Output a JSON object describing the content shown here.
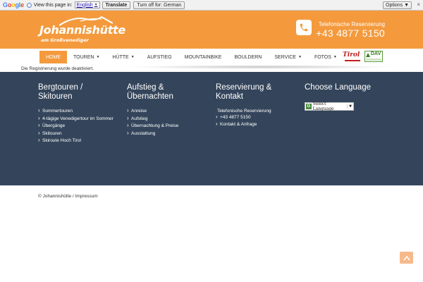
{
  "translate_bar": {
    "logo_letters": [
      "G",
      "o",
      "o",
      "g",
      "l",
      "e"
    ],
    "view_label": "View this page in:",
    "language": "English",
    "translate_button": "Translate",
    "turn_off_button": "Turn off for: German",
    "options_button": "Options ▼",
    "close": "×"
  },
  "header": {
    "logo_name": "Johannishütte",
    "logo_sub": "am Großvenediger",
    "phone_label": "Telefonische Reservierung",
    "phone_number": "+43 4877 5150",
    "accent_color": "#f49a3d"
  },
  "nav": {
    "items": [
      {
        "label": "HOME",
        "caret": ""
      },
      {
        "label": "TOUREN",
        "caret": "▼"
      },
      {
        "label": "HÜTTE",
        "caret": "▼"
      },
      {
        "label": "AUFSTIEG",
        "caret": ""
      },
      {
        "label": "MOUNTAINBIKE",
        "caret": ""
      },
      {
        "label": "BOULDERN",
        "caret": ""
      },
      {
        "label": "SERVICE",
        "caret": "▼"
      },
      {
        "label": "FOTOS",
        "caret": "▼"
      }
    ],
    "tirol_logo": "Tirol",
    "dav_logo": "DAV"
  },
  "notice": "Die Registrierung wurde deaktiviert.",
  "footer": {
    "background": "#34455b",
    "col1": {
      "title": "Bergtouren / Skitouren",
      "links": [
        "Sommertouren",
        "4-tägige Venedigertour im Sommer",
        "Übergänge",
        "Skitouren",
        "Skiroute Hoch Tirol"
      ]
    },
    "col2": {
      "title": "Aufstieg & Übernachten",
      "links": [
        "Anreise",
        "Aufstieg",
        "Übernachtung & Preise",
        "Ausstattung"
      ]
    },
    "col3": {
      "title": "Reservierung & Kontakt",
      "plain": "Telefonische Reservierung",
      "links": [
        "+43 4877 5150",
        "Kontakt & Anfrage"
      ]
    },
    "col4": {
      "title": "Choose Language",
      "select_label": "Select Language",
      "select_arrow": "▼",
      "g": "G"
    }
  },
  "copyright": "© Johannishütte / Impressum"
}
